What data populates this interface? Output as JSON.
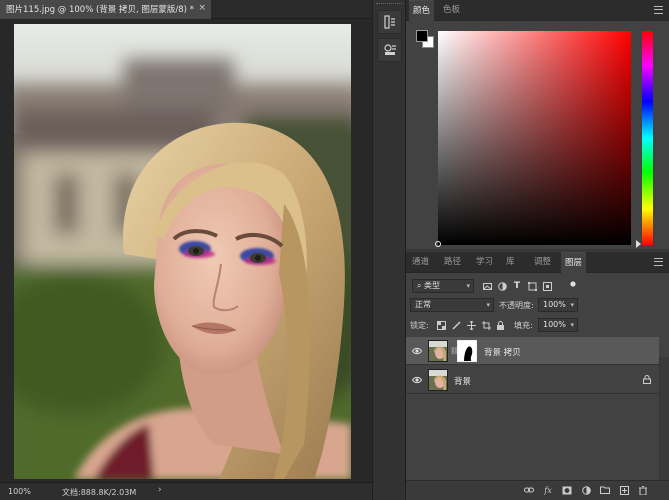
{
  "document": {
    "tab_title": "图片115.jpg @ 100% (背景 拷贝, 图层蒙版/8) *",
    "close_glyph": "×"
  },
  "status": {
    "zoom": "100%",
    "doc_info": "文档:888.8K/2.03M",
    "arrow_glyph": "›"
  },
  "color_panel": {
    "tabs": [
      "颜色",
      "色板"
    ],
    "active_tab": "颜色",
    "foreground": "#000000",
    "background": "#ffffff"
  },
  "layers_panel": {
    "tabs": [
      "通道",
      "路径",
      "学习",
      "库",
      "调整",
      "图层"
    ],
    "active_tab": "图层",
    "filter_kind": "类型",
    "blend_mode": "正常",
    "opacity_label": "不透明度:",
    "opacity_value": "100%",
    "lock_label": "锁定:",
    "fill_label": "填充:",
    "fill_value": "100%",
    "layers": [
      {
        "name": "背景 拷贝",
        "visible": true,
        "selected": true,
        "has_mask": true
      },
      {
        "name": "背景",
        "visible": true,
        "selected": false,
        "locked": true
      }
    ],
    "footer_fx": "fx"
  },
  "colors": {
    "ui_dark": "#282828",
    "panel": "#424242",
    "selected_layer": "#595959"
  }
}
